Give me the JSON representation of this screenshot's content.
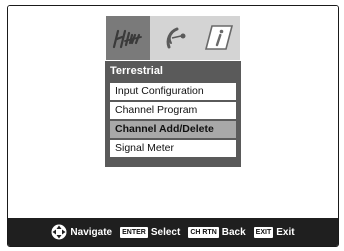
{
  "icon_tabs": [
    {
      "icon": "antenna-icon",
      "selected": true
    },
    {
      "icon": "satellite-dish-icon",
      "selected": false
    },
    {
      "icon": "info-icon",
      "selected": false
    }
  ],
  "panel": {
    "title": "Terrestrial",
    "items": [
      {
        "label": "Input Configuration",
        "selected": false
      },
      {
        "label": "Channel Program",
        "selected": false
      },
      {
        "label": "Channel Add/Delete",
        "selected": true
      },
      {
        "label": "Signal Meter",
        "selected": false
      }
    ]
  },
  "footer": {
    "navigate": {
      "icon": "navigate-dpad-icon",
      "label": "Navigate"
    },
    "select": {
      "key": "ENTER",
      "label": "Select"
    },
    "back": {
      "key": "CH RTN",
      "label": "Back"
    },
    "exit": {
      "key": "EXIT",
      "label": "Exit"
    }
  }
}
